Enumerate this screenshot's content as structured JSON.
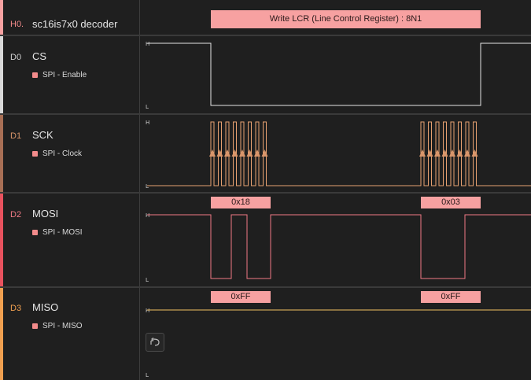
{
  "decoder": {
    "id": "H0.",
    "name": "sc16is7x0 decoder",
    "annotation": "Write LCR (Line Control Register) : 8N1"
  },
  "channels": [
    {
      "id": "D0",
      "name": "CS",
      "sub_label": "SPI - Enable",
      "color": "#d9d9d9"
    },
    {
      "id": "D1",
      "name": "SCK",
      "sub_label": "SPI - Clock",
      "color": "#a86f55"
    },
    {
      "id": "D2",
      "name": "MOSI",
      "sub_label": "SPI - MOSI",
      "color": "#e8525e"
    },
    {
      "id": "D3",
      "name": "MISO",
      "sub_label": "SPI - MISO",
      "color": "#f0a050"
    }
  ],
  "level_labels": {
    "high": "H",
    "low": "L"
  },
  "mosi_bytes": [
    "0x18",
    "0x03"
  ],
  "miso_bytes": [
    "0xFF",
    "0xFF"
  ],
  "colors": {
    "background": "#1f1f1f",
    "annotation": "#f7a1a1",
    "cs_trace": "#e6e6e6",
    "sck_trace": "#e5a070",
    "mosi_trace": "#f07a85",
    "miso_trace": "#f0c060"
  },
  "icons": {
    "undo": "undo-icon"
  }
}
